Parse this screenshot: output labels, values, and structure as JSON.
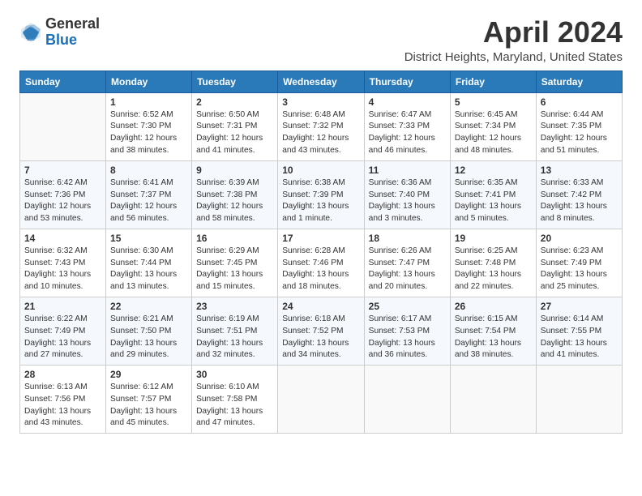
{
  "logo": {
    "general": "General",
    "blue": "Blue"
  },
  "title": "April 2024",
  "location": "District Heights, Maryland, United States",
  "days_header": [
    "Sunday",
    "Monday",
    "Tuesday",
    "Wednesday",
    "Thursday",
    "Friday",
    "Saturday"
  ],
  "weeks": [
    [
      {
        "day": "",
        "info": ""
      },
      {
        "day": "1",
        "info": "Sunrise: 6:52 AM\nSunset: 7:30 PM\nDaylight: 12 hours\nand 38 minutes."
      },
      {
        "day": "2",
        "info": "Sunrise: 6:50 AM\nSunset: 7:31 PM\nDaylight: 12 hours\nand 41 minutes."
      },
      {
        "day": "3",
        "info": "Sunrise: 6:48 AM\nSunset: 7:32 PM\nDaylight: 12 hours\nand 43 minutes."
      },
      {
        "day": "4",
        "info": "Sunrise: 6:47 AM\nSunset: 7:33 PM\nDaylight: 12 hours\nand 46 minutes."
      },
      {
        "day": "5",
        "info": "Sunrise: 6:45 AM\nSunset: 7:34 PM\nDaylight: 12 hours\nand 48 minutes."
      },
      {
        "day": "6",
        "info": "Sunrise: 6:44 AM\nSunset: 7:35 PM\nDaylight: 12 hours\nand 51 minutes."
      }
    ],
    [
      {
        "day": "7",
        "info": "Sunrise: 6:42 AM\nSunset: 7:36 PM\nDaylight: 12 hours\nand 53 minutes."
      },
      {
        "day": "8",
        "info": "Sunrise: 6:41 AM\nSunset: 7:37 PM\nDaylight: 12 hours\nand 56 minutes."
      },
      {
        "day": "9",
        "info": "Sunrise: 6:39 AM\nSunset: 7:38 PM\nDaylight: 12 hours\nand 58 minutes."
      },
      {
        "day": "10",
        "info": "Sunrise: 6:38 AM\nSunset: 7:39 PM\nDaylight: 13 hours\nand 1 minute."
      },
      {
        "day": "11",
        "info": "Sunrise: 6:36 AM\nSunset: 7:40 PM\nDaylight: 13 hours\nand 3 minutes."
      },
      {
        "day": "12",
        "info": "Sunrise: 6:35 AM\nSunset: 7:41 PM\nDaylight: 13 hours\nand 5 minutes."
      },
      {
        "day": "13",
        "info": "Sunrise: 6:33 AM\nSunset: 7:42 PM\nDaylight: 13 hours\nand 8 minutes."
      }
    ],
    [
      {
        "day": "14",
        "info": "Sunrise: 6:32 AM\nSunset: 7:43 PM\nDaylight: 13 hours\nand 10 minutes."
      },
      {
        "day": "15",
        "info": "Sunrise: 6:30 AM\nSunset: 7:44 PM\nDaylight: 13 hours\nand 13 minutes."
      },
      {
        "day": "16",
        "info": "Sunrise: 6:29 AM\nSunset: 7:45 PM\nDaylight: 13 hours\nand 15 minutes."
      },
      {
        "day": "17",
        "info": "Sunrise: 6:28 AM\nSunset: 7:46 PM\nDaylight: 13 hours\nand 18 minutes."
      },
      {
        "day": "18",
        "info": "Sunrise: 6:26 AM\nSunset: 7:47 PM\nDaylight: 13 hours\nand 20 minutes."
      },
      {
        "day": "19",
        "info": "Sunrise: 6:25 AM\nSunset: 7:48 PM\nDaylight: 13 hours\nand 22 minutes."
      },
      {
        "day": "20",
        "info": "Sunrise: 6:23 AM\nSunset: 7:49 PM\nDaylight: 13 hours\nand 25 minutes."
      }
    ],
    [
      {
        "day": "21",
        "info": "Sunrise: 6:22 AM\nSunset: 7:49 PM\nDaylight: 13 hours\nand 27 minutes."
      },
      {
        "day": "22",
        "info": "Sunrise: 6:21 AM\nSunset: 7:50 PM\nDaylight: 13 hours\nand 29 minutes."
      },
      {
        "day": "23",
        "info": "Sunrise: 6:19 AM\nSunset: 7:51 PM\nDaylight: 13 hours\nand 32 minutes."
      },
      {
        "day": "24",
        "info": "Sunrise: 6:18 AM\nSunset: 7:52 PM\nDaylight: 13 hours\nand 34 minutes."
      },
      {
        "day": "25",
        "info": "Sunrise: 6:17 AM\nSunset: 7:53 PM\nDaylight: 13 hours\nand 36 minutes."
      },
      {
        "day": "26",
        "info": "Sunrise: 6:15 AM\nSunset: 7:54 PM\nDaylight: 13 hours\nand 38 minutes."
      },
      {
        "day": "27",
        "info": "Sunrise: 6:14 AM\nSunset: 7:55 PM\nDaylight: 13 hours\nand 41 minutes."
      }
    ],
    [
      {
        "day": "28",
        "info": "Sunrise: 6:13 AM\nSunset: 7:56 PM\nDaylight: 13 hours\nand 43 minutes."
      },
      {
        "day": "29",
        "info": "Sunrise: 6:12 AM\nSunset: 7:57 PM\nDaylight: 13 hours\nand 45 minutes."
      },
      {
        "day": "30",
        "info": "Sunrise: 6:10 AM\nSunset: 7:58 PM\nDaylight: 13 hours\nand 47 minutes."
      },
      {
        "day": "",
        "info": ""
      },
      {
        "day": "",
        "info": ""
      },
      {
        "day": "",
        "info": ""
      },
      {
        "day": "",
        "info": ""
      }
    ]
  ]
}
